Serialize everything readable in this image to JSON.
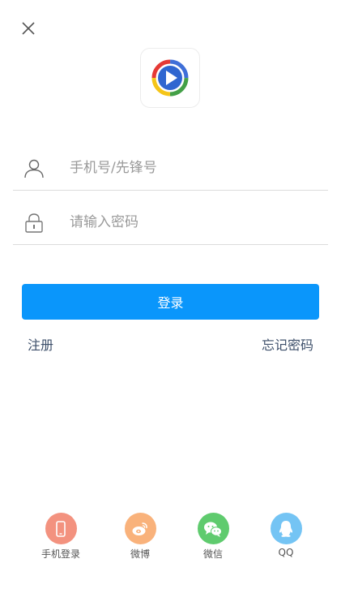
{
  "login_form": {
    "phone_placeholder": "手机号/先锋号",
    "phone_value": "",
    "password_placeholder": "请输入密码",
    "password_value": "",
    "login_button": "登录",
    "register_link": "注册",
    "forgot_password_link": "忘记密码"
  },
  "social_login": [
    {
      "label": "手机登录",
      "icon": "phone-icon",
      "color": "#f3927f"
    },
    {
      "label": "微博",
      "icon": "weibo-icon",
      "color": "#f9b27b"
    },
    {
      "label": "微信",
      "icon": "wechat-icon",
      "color": "#5fcb6e"
    },
    {
      "label": "QQ",
      "icon": "qq-icon",
      "color": "#74c4f4"
    }
  ],
  "colors": {
    "primary": "#0a96fb",
    "link": "#3d4f6a",
    "divider": "#dcdcdc"
  }
}
